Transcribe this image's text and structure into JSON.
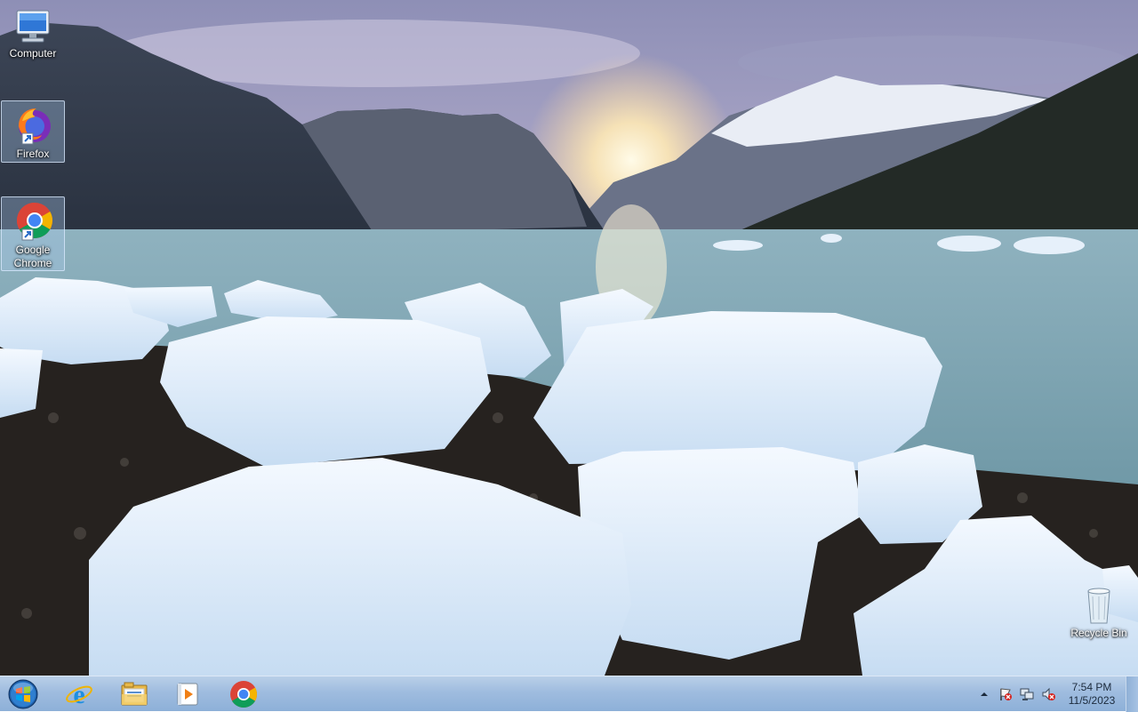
{
  "desktop": {
    "icons": [
      {
        "label": "Computer"
      },
      {
        "label": "Firefox"
      },
      {
        "label": "Google Chrome"
      },
      {
        "label": "Recycle Bin"
      }
    ]
  },
  "taskbar": {
    "start_icon": "windows-orb-icon",
    "pinned": [
      {
        "name": "internet-explorer-icon"
      },
      {
        "name": "file-explorer-icon"
      },
      {
        "name": "media-player-icon"
      },
      {
        "name": "chrome-icon"
      }
    ],
    "tray": {
      "icons": [
        "show-hidden-icons-arrow",
        "action-center-flag-icon",
        "network-icon",
        "volume-muted-icon"
      ],
      "time": "7:54 PM",
      "date": "11/5/2023"
    }
  },
  "colors": {
    "taskbar": "#9fbcdf",
    "sky": "#b8b6d8",
    "water": "#7fa6b3"
  }
}
